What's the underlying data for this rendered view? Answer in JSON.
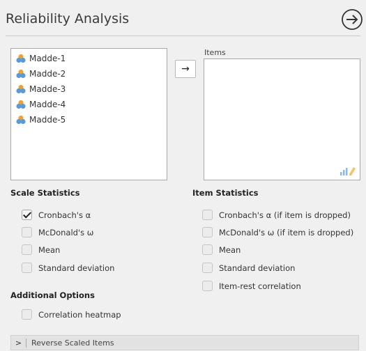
{
  "header": {
    "title": "Reliability Analysis",
    "next_icon": "arrow-right-circle-icon"
  },
  "variables": {
    "items": [
      {
        "label": "Madde-1",
        "icon": "nominal-variable-icon"
      },
      {
        "label": "Madde-2",
        "icon": "nominal-variable-icon"
      },
      {
        "label": "Madde-3",
        "icon": "nominal-variable-icon"
      },
      {
        "label": "Madde-4",
        "icon": "nominal-variable-icon"
      },
      {
        "label": "Madde-5",
        "icon": "nominal-variable-icon"
      }
    ]
  },
  "move_button": {
    "label": "→"
  },
  "items_box": {
    "label": "Items"
  },
  "scale_statistics": {
    "title": "Scale Statistics",
    "options": [
      {
        "label": "Cronbach's α",
        "checked": true
      },
      {
        "label": "McDonald's ω",
        "checked": false
      },
      {
        "label": "Mean",
        "checked": false
      },
      {
        "label": "Standard deviation",
        "checked": false
      }
    ]
  },
  "item_statistics": {
    "title": "Item Statistics",
    "options": [
      {
        "label": "Cronbach's α (if item is dropped)",
        "checked": false
      },
      {
        "label": "McDonald's ω (if item is dropped)",
        "checked": false
      },
      {
        "label": "Mean",
        "checked": false
      },
      {
        "label": "Standard deviation",
        "checked": false
      },
      {
        "label": "Item-rest correlation",
        "checked": false
      }
    ]
  },
  "additional_options": {
    "title": "Additional Options",
    "options": [
      {
        "label": "Correlation heatmap",
        "checked": false
      }
    ]
  },
  "reverse_scaled": {
    "label": "Reverse Scaled Items"
  },
  "colors": {
    "accent_blue": "#5b9bd5",
    "accent_orange": "#f0a030"
  }
}
